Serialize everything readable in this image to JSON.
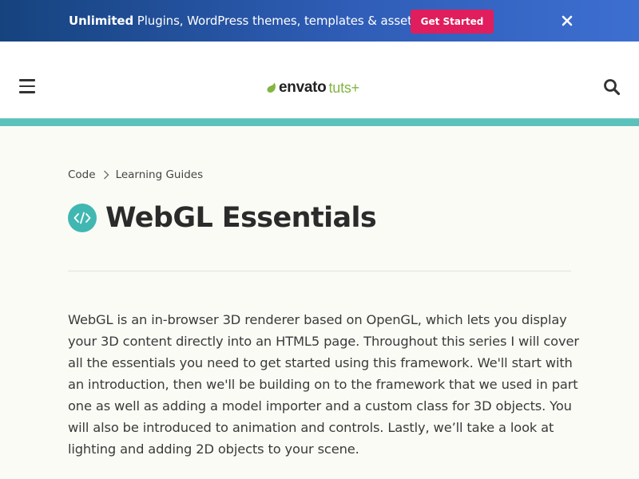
{
  "promo": {
    "bold_text": "Unlimited",
    "text": " Plugins, WordPress themes, templates & assets!",
    "button_label": "Get Started"
  },
  "header": {
    "logo_primary": "envato",
    "logo_secondary": "tuts+",
    "icons": [
      "menu-icon",
      "search-icon",
      "close-icon"
    ]
  },
  "breadcrumb": {
    "items": [
      "Code",
      "Learning Guides"
    ]
  },
  "page": {
    "title": "WebGL Essentials",
    "category_icon": "code-icon",
    "description": "WebGL is an in-browser 3D renderer based on OpenGL, which lets you display your 3D content directly into an HTML5 page. Throughout this series I will cover all the essentials you need to get started using this framework. We'll start with an introduction, then we'll be building on to the framework that we used in part one as well as adding a model importer and a custom class for 3D objects. You will also be introduced to animation and controls. Lastly, we’ll take a look at lighting and adding 2D objects to your scene."
  },
  "colors": {
    "promo_start": "#16437e",
    "promo_end": "#3d6fd1",
    "cta": "#e01d5d",
    "accent": "#5bc2bb",
    "logo_green": "#82b541",
    "icon_teal": "#41b7b2"
  }
}
